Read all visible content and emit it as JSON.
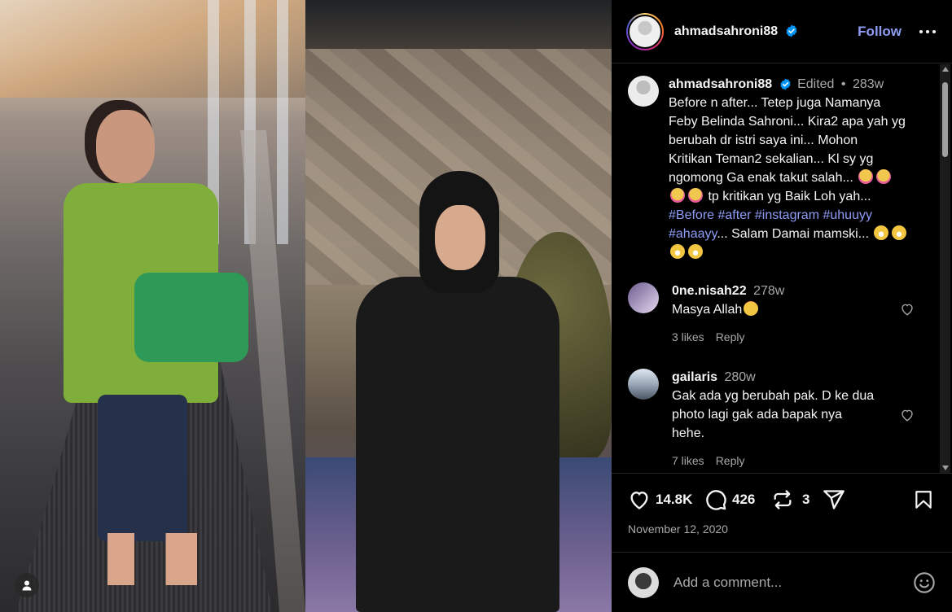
{
  "post": {
    "username": "ahmadsahroni88",
    "follow_label": "Follow",
    "edited_label": "Edited",
    "dot": "•",
    "age": "283w",
    "caption_lines": [
      "Before n after... Tetep juga Namanya",
      "Feby Belinda Sahroni... Kira2 apa yah yg",
      "berubah dr istri saya ini... Mohon",
      "Kritikan Teman2 sekalian... Kl sy yg",
      "ngomong Ga enak takut salah..."
    ],
    "caption_line6": "tp kritikan yg Baik Loh yah...",
    "hashtags": [
      "#Before",
      "#after",
      "#instagram",
      "#uhuuyy",
      "#ahaayy"
    ],
    "caption_tail": "... Salam Damai mamski...",
    "likes": "14.8K",
    "comments_count": "426",
    "reposts": "3",
    "date": "November 12, 2020"
  },
  "comments": [
    {
      "username": "0ne.nisah22",
      "age": "278w",
      "text": "Masya Allah",
      "likes_label": "3 likes",
      "reply_label": "Reply"
    },
    {
      "username": "gailaris",
      "age": "280w",
      "text_lines": [
        "Gak ada yg berubah pak. D ke dua",
        "photo lagi gak ada bapak nya",
        "hehe."
      ],
      "likes_label": "7 likes",
      "reply_label": "Reply"
    }
  ],
  "comment_box": {
    "placeholder": "Add a comment..."
  },
  "icons": {
    "verified": "verified-badge-icon",
    "more": "more-options-icon",
    "like": "heart-icon",
    "comment": "comment-bubble-icon",
    "repost": "repost-icon",
    "share": "send-icon",
    "save": "bookmark-icon",
    "emoji": "emoji-icon",
    "profile": "user-tag-icon"
  },
  "colors": {
    "accent": "#8e9cf5",
    "verified": "#0095f6",
    "muted": "#a8a8a8"
  }
}
